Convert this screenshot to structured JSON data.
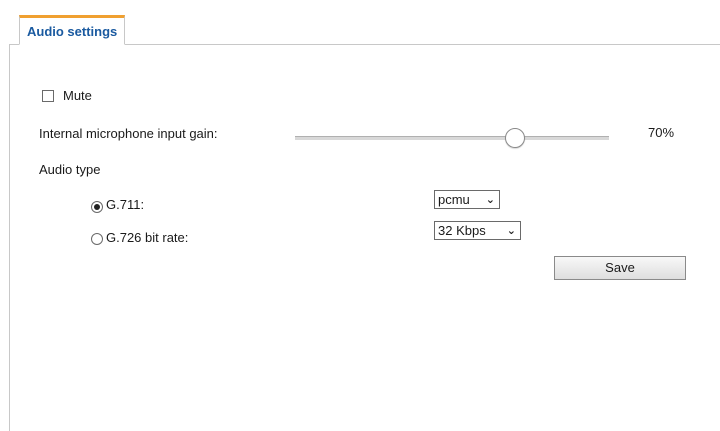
{
  "tab": {
    "label": "Audio settings"
  },
  "mute": {
    "label": "Mute",
    "checked": false
  },
  "gain": {
    "label": "Internal microphone input gain:",
    "value_text": "70%",
    "value": 70
  },
  "audio_type": {
    "label": "Audio type",
    "options": [
      {
        "label": "G.711:",
        "selected": true,
        "select_value": "pcmu"
      },
      {
        "label": "G.726 bit rate:",
        "selected": false,
        "select_value": "32 Kbps"
      }
    ]
  },
  "save": {
    "label": "Save"
  },
  "icons": {
    "dropdown": "chevron-down-icon"
  },
  "colors": {
    "tab_text": "#1a5aa0",
    "tab_accent": "#f0a030"
  }
}
